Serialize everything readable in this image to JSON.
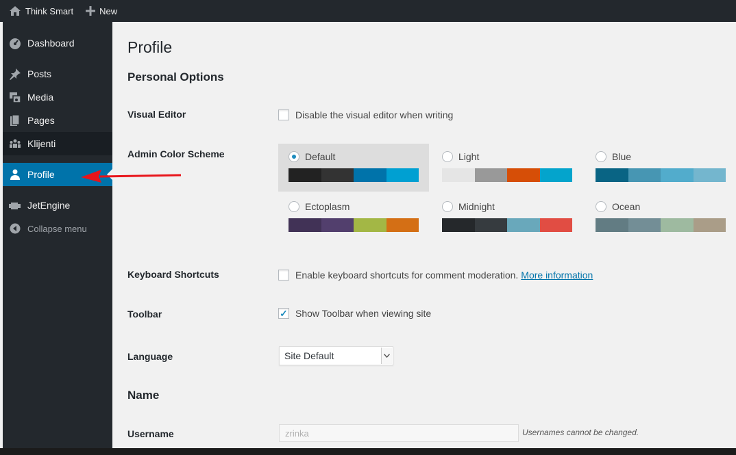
{
  "adminbar": {
    "site_name": "Think Smart",
    "new_label": "New"
  },
  "sidebar": {
    "items": [
      {
        "label": "Dashboard",
        "icon": "dashboard-icon"
      },
      {
        "label": "Posts",
        "icon": "pin-icon"
      },
      {
        "label": "Media",
        "icon": "media-icon"
      },
      {
        "label": "Pages",
        "icon": "pages-icon"
      },
      {
        "label": "Klijenti",
        "icon": "groups-icon"
      },
      {
        "label": "Profile",
        "icon": "user-icon"
      },
      {
        "label": "JetEngine",
        "icon": "jetengine-icon"
      },
      {
        "label": "Collapse menu",
        "icon": "collapse-icon"
      }
    ]
  },
  "page": {
    "title": "Profile",
    "personal_options_heading": "Personal Options",
    "visual_editor": {
      "label": "Visual Editor",
      "option": "Disable the visual editor when writing",
      "checked": false
    },
    "admin_color_scheme": {
      "label": "Admin Color Scheme",
      "schemes": [
        {
          "name": "Default",
          "selected": true,
          "colors": [
            "#222222",
            "#333333",
            "#0073aa",
            "#00a0d2"
          ]
        },
        {
          "name": "Light",
          "selected": false,
          "colors": [
            "#e5e5e5",
            "#999999",
            "#d64e07",
            "#04a4cc"
          ]
        },
        {
          "name": "Blue",
          "selected": false,
          "colors": [
            "#096484",
            "#4796b3",
            "#52accc",
            "#74b6ce"
          ]
        },
        {
          "name": "Ectoplasm",
          "selected": false,
          "colors": [
            "#413256",
            "#523f6d",
            "#a3b745",
            "#d46f15"
          ]
        },
        {
          "name": "Midnight",
          "selected": false,
          "colors": [
            "#25282b",
            "#363b3f",
            "#69a8bb",
            "#e14d43"
          ]
        },
        {
          "name": "Ocean",
          "selected": false,
          "colors": [
            "#627c83",
            "#738e96",
            "#9ebaa0",
            "#aa9d88"
          ]
        }
      ]
    },
    "keyboard_shortcuts": {
      "label": "Keyboard Shortcuts",
      "option": "Enable keyboard shortcuts for comment moderation.",
      "link": "More information",
      "checked": false
    },
    "toolbar": {
      "label": "Toolbar",
      "option": "Show Toolbar when viewing site",
      "checked": true
    },
    "language": {
      "label": "Language",
      "value": "Site Default"
    },
    "name_heading": "Name",
    "username": {
      "label": "Username",
      "value": "zrinka",
      "description": "Usernames cannot be changed."
    }
  },
  "colors": {
    "adminbar_bg": "#23282d",
    "menu_active": "#0073aa",
    "annotation_arrow": "#e8141a"
  }
}
